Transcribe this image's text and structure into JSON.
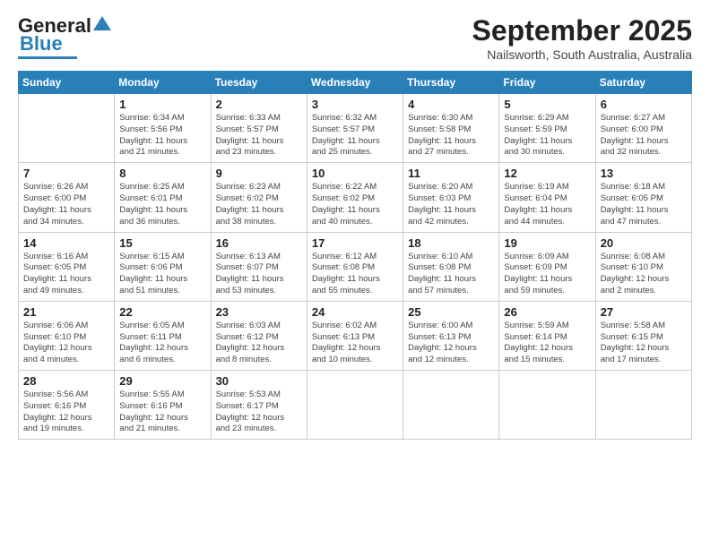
{
  "header": {
    "logo_line1": "General",
    "logo_line2": "Blue",
    "title": "September 2025",
    "subtitle": "Nailsworth, South Australia, Australia"
  },
  "calendar": {
    "days_of_week": [
      "Sunday",
      "Monday",
      "Tuesday",
      "Wednesday",
      "Thursday",
      "Friday",
      "Saturday"
    ],
    "weeks": [
      [
        {
          "day": "",
          "info": ""
        },
        {
          "day": "1",
          "info": "Sunrise: 6:34 AM\nSunset: 5:56 PM\nDaylight: 11 hours\nand 21 minutes."
        },
        {
          "day": "2",
          "info": "Sunrise: 6:33 AM\nSunset: 5:57 PM\nDaylight: 11 hours\nand 23 minutes."
        },
        {
          "day": "3",
          "info": "Sunrise: 6:32 AM\nSunset: 5:57 PM\nDaylight: 11 hours\nand 25 minutes."
        },
        {
          "day": "4",
          "info": "Sunrise: 6:30 AM\nSunset: 5:58 PM\nDaylight: 11 hours\nand 27 minutes."
        },
        {
          "day": "5",
          "info": "Sunrise: 6:29 AM\nSunset: 5:59 PM\nDaylight: 11 hours\nand 30 minutes."
        },
        {
          "day": "6",
          "info": "Sunrise: 6:27 AM\nSunset: 6:00 PM\nDaylight: 11 hours\nand 32 minutes."
        }
      ],
      [
        {
          "day": "7",
          "info": "Sunrise: 6:26 AM\nSunset: 6:00 PM\nDaylight: 11 hours\nand 34 minutes."
        },
        {
          "day": "8",
          "info": "Sunrise: 6:25 AM\nSunset: 6:01 PM\nDaylight: 11 hours\nand 36 minutes."
        },
        {
          "day": "9",
          "info": "Sunrise: 6:23 AM\nSunset: 6:02 PM\nDaylight: 11 hours\nand 38 minutes."
        },
        {
          "day": "10",
          "info": "Sunrise: 6:22 AM\nSunset: 6:02 PM\nDaylight: 11 hours\nand 40 minutes."
        },
        {
          "day": "11",
          "info": "Sunrise: 6:20 AM\nSunset: 6:03 PM\nDaylight: 11 hours\nand 42 minutes."
        },
        {
          "day": "12",
          "info": "Sunrise: 6:19 AM\nSunset: 6:04 PM\nDaylight: 11 hours\nand 44 minutes."
        },
        {
          "day": "13",
          "info": "Sunrise: 6:18 AM\nSunset: 6:05 PM\nDaylight: 11 hours\nand 47 minutes."
        }
      ],
      [
        {
          "day": "14",
          "info": "Sunrise: 6:16 AM\nSunset: 6:05 PM\nDaylight: 11 hours\nand 49 minutes."
        },
        {
          "day": "15",
          "info": "Sunrise: 6:15 AM\nSunset: 6:06 PM\nDaylight: 11 hours\nand 51 minutes."
        },
        {
          "day": "16",
          "info": "Sunrise: 6:13 AM\nSunset: 6:07 PM\nDaylight: 11 hours\nand 53 minutes."
        },
        {
          "day": "17",
          "info": "Sunrise: 6:12 AM\nSunset: 6:08 PM\nDaylight: 11 hours\nand 55 minutes."
        },
        {
          "day": "18",
          "info": "Sunrise: 6:10 AM\nSunset: 6:08 PM\nDaylight: 11 hours\nand 57 minutes."
        },
        {
          "day": "19",
          "info": "Sunrise: 6:09 AM\nSunset: 6:09 PM\nDaylight: 11 hours\nand 59 minutes."
        },
        {
          "day": "20",
          "info": "Sunrise: 6:08 AM\nSunset: 6:10 PM\nDaylight: 12 hours\nand 2 minutes."
        }
      ],
      [
        {
          "day": "21",
          "info": "Sunrise: 6:06 AM\nSunset: 6:10 PM\nDaylight: 12 hours\nand 4 minutes."
        },
        {
          "day": "22",
          "info": "Sunrise: 6:05 AM\nSunset: 6:11 PM\nDaylight: 12 hours\nand 6 minutes."
        },
        {
          "day": "23",
          "info": "Sunrise: 6:03 AM\nSunset: 6:12 PM\nDaylight: 12 hours\nand 8 minutes."
        },
        {
          "day": "24",
          "info": "Sunrise: 6:02 AM\nSunset: 6:13 PM\nDaylight: 12 hours\nand 10 minutes."
        },
        {
          "day": "25",
          "info": "Sunrise: 6:00 AM\nSunset: 6:13 PM\nDaylight: 12 hours\nand 12 minutes."
        },
        {
          "day": "26",
          "info": "Sunrise: 5:59 AM\nSunset: 6:14 PM\nDaylight: 12 hours\nand 15 minutes."
        },
        {
          "day": "27",
          "info": "Sunrise: 5:58 AM\nSunset: 6:15 PM\nDaylight: 12 hours\nand 17 minutes."
        }
      ],
      [
        {
          "day": "28",
          "info": "Sunrise: 5:56 AM\nSunset: 6:16 PM\nDaylight: 12 hours\nand 19 minutes."
        },
        {
          "day": "29",
          "info": "Sunrise: 5:55 AM\nSunset: 6:16 PM\nDaylight: 12 hours\nand 21 minutes."
        },
        {
          "day": "30",
          "info": "Sunrise: 5:53 AM\nSunset: 6:17 PM\nDaylight: 12 hours\nand 23 minutes."
        },
        {
          "day": "",
          "info": ""
        },
        {
          "day": "",
          "info": ""
        },
        {
          "day": "",
          "info": ""
        },
        {
          "day": "",
          "info": ""
        }
      ]
    ]
  }
}
